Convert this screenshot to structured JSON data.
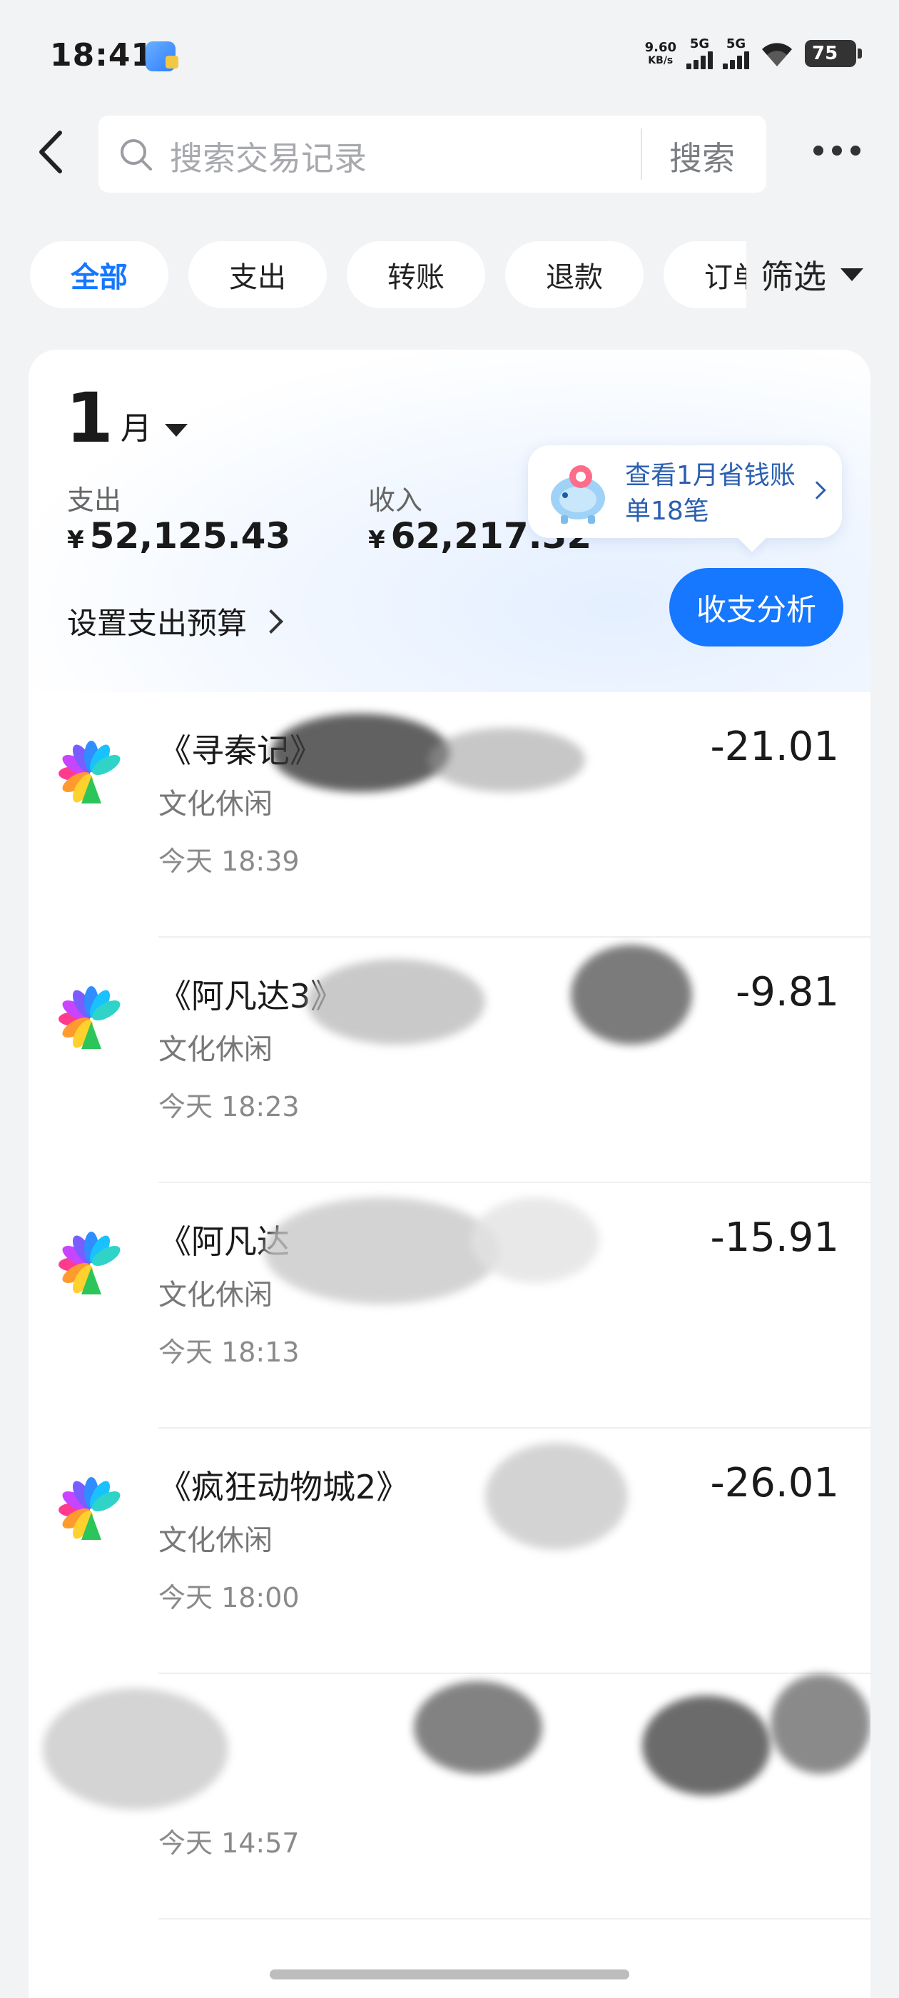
{
  "status": {
    "time": "18:41",
    "net_speed_value": "9.60",
    "net_speed_unit": "KB/s",
    "sim1": "5G",
    "sim2": "5G",
    "battery": "75"
  },
  "topbar": {
    "search_placeholder": "搜索交易记录",
    "search_button": "搜索"
  },
  "filters": {
    "chips": [
      "全部",
      "支出",
      "转账",
      "退款",
      "订单"
    ],
    "active": "全部",
    "filter_label": "筛选"
  },
  "summary": {
    "month_number": "1",
    "month_unit": "月",
    "expense_label": "支出",
    "expense_currency": "¥",
    "expense_value": "52,125.43",
    "income_label": "收入",
    "income_currency": "¥",
    "income_value": "62,217.32",
    "promo_text": "查看1月省钱账单18笔",
    "budget_label": "设置支出预算",
    "analysis_button": "收支分析"
  },
  "transactions": [
    {
      "title": "《寻秦记》",
      "category": "文化休闲",
      "time": "今天 18:39",
      "amount": "-21.01"
    },
    {
      "title": "《阿凡达3》",
      "category": "文化休闲",
      "time": "今天 18:23",
      "amount": "-9.81"
    },
    {
      "title": "《阿凡达",
      "category": "文化休闲",
      "time": "今天 18:13",
      "amount": "-15.91"
    },
    {
      "title": "《疯狂动物城2》",
      "category": "文化休闲",
      "time": "今天 18:00",
      "amount": "-26.01"
    },
    {
      "title": "",
      "category": "",
      "time": "今天 14:57",
      "amount": ""
    }
  ]
}
